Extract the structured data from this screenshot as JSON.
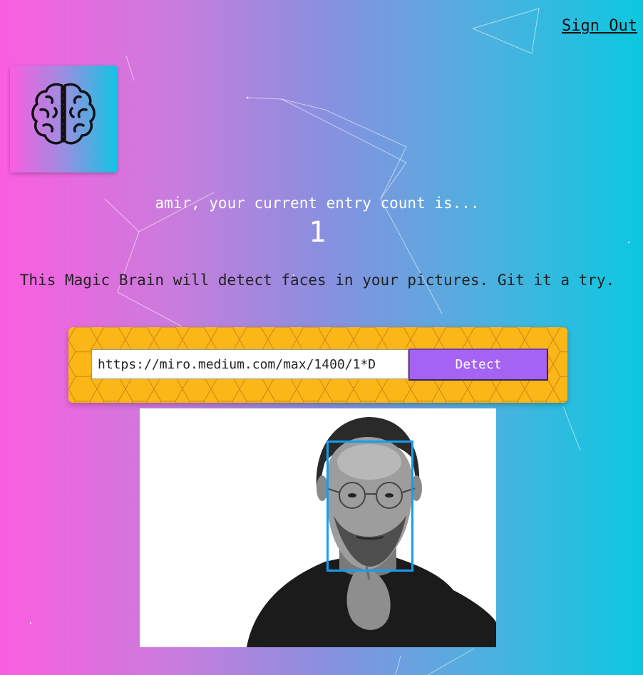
{
  "nav": {
    "signout_label": "Sign Out"
  },
  "logo": {
    "icon": "brain-icon"
  },
  "rank": {
    "message": "amir, your current entry count is...",
    "count": "1"
  },
  "intro": {
    "text": "This Magic Brain will detect faces in your pictures. Git it a try."
  },
  "form": {
    "url_value": "https://miro.medium.com/max/1400/1*D",
    "detect_label": "Detect"
  },
  "image": {
    "subject": "face-photo",
    "face_boxes_count": 1
  },
  "colors": {
    "gradient_left": "#fb5ee0",
    "gradient_right": "#0bc8e0",
    "form_background": "#fbb617",
    "button": "#a463f2",
    "face_box": "#149df2"
  }
}
